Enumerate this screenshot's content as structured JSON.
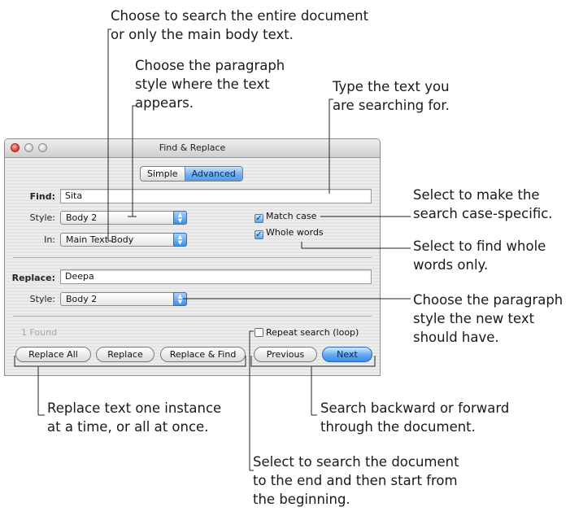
{
  "window": {
    "title": "Find & Replace",
    "tabs": [
      "Simple",
      "Advanced"
    ],
    "active_tab": "Advanced",
    "find_label": "Find:",
    "find_value": "Sita",
    "style_label": "Style:",
    "find_style_value": "Body 2",
    "in_label": "In:",
    "in_value": "Main Text Body",
    "match_case_label": "Match case",
    "match_case_checked": true,
    "whole_words_label": "Whole words",
    "whole_words_checked": true,
    "replace_label": "Replace:",
    "replace_value": "Deepa",
    "replace_style_label": "Style:",
    "replace_style_value": "Body 2",
    "found_status": "1 Found",
    "repeat_label": "Repeat search (loop)",
    "repeat_checked": false,
    "buttons": {
      "replace_all": "Replace All",
      "replace": "Replace",
      "replace_find": "Replace & Find",
      "previous": "Previous",
      "next": "Next"
    }
  },
  "callouts": {
    "search_scope": [
      "Choose to search the entire document",
      "or only the main body text."
    ],
    "paragraph_style": [
      "Choose the paragraph",
      "style where the text",
      "appears."
    ],
    "type_text": [
      "Type the text you",
      "are searching for."
    ],
    "match_case": [
      "Select to make the",
      "search case-specific."
    ],
    "whole_words": [
      "Select to find whole",
      "words only."
    ],
    "new_style": [
      "Choose the paragraph",
      "style the new text",
      "should have."
    ],
    "replace_buttons": [
      "Replace text one instance",
      "at a time, or all at once."
    ],
    "nav_buttons": [
      "Search backward or forward",
      "through the document."
    ],
    "repeat": [
      "Select to search the document",
      "to the end and then start from",
      "the beginning."
    ]
  }
}
